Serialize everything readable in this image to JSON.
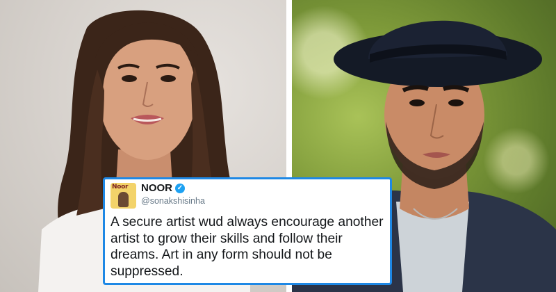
{
  "tweet": {
    "display_name": "NOOR",
    "handle": "@sonakshisinha",
    "text": "A secure artist wud always encourage another artist to grow their skills and follow their dreams. Art in any form should not be suppressed.",
    "avatar_label": "Noor"
  },
  "icons": {
    "verified": "verified-badge-icon"
  },
  "colors": {
    "card_border": "#1e88e5",
    "verified_badge": "#1da1f2",
    "handle_text": "#657786"
  }
}
